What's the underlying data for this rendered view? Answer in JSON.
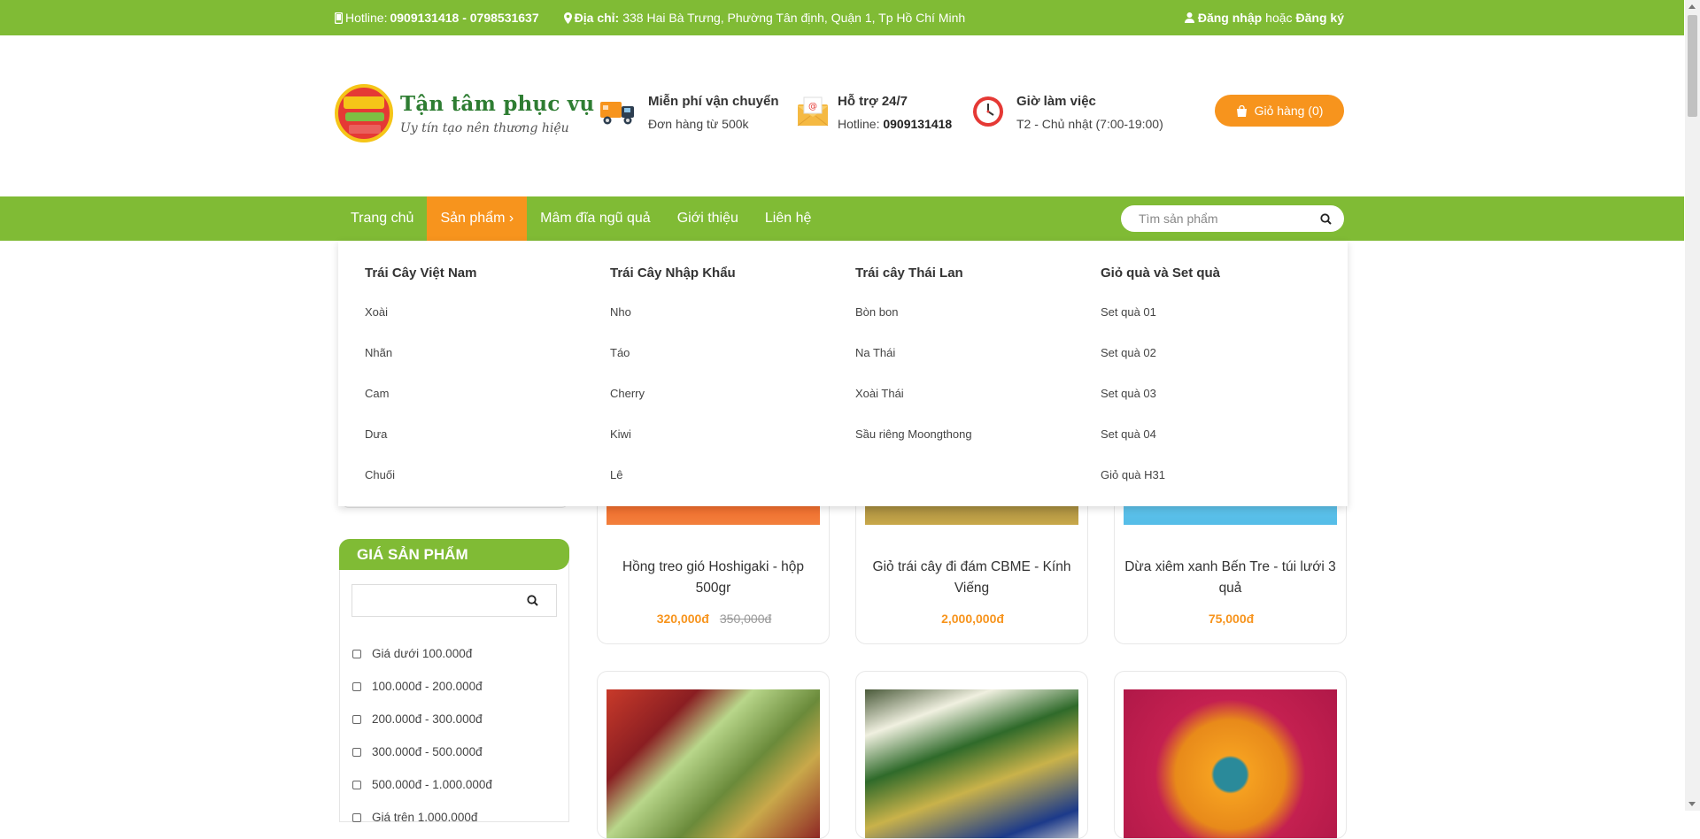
{
  "topbar": {
    "hotline_label": "Hotline:",
    "hotline_value": "0909131418 - 0798531637",
    "address_label": "Địa chỉ:",
    "address_value": "338 Hai Bà Trưng, Phường Tân định, Quận 1, Tp Hồ Chí Minh",
    "login": "Đăng nhập",
    "or": "hoặc",
    "register": "Đăng ký"
  },
  "header": {
    "logo_title": "Tận tâm phục vụ",
    "logo_slogan": "Uy tín tạo nên thương hiệu",
    "features": [
      {
        "icon": "delivery-truck-icon",
        "title": "Miễn phí vận chuyển",
        "sub": "Đơn hàng từ 500k"
      },
      {
        "icon": "email-support-icon",
        "title": "Hỗ trợ 24/7",
        "sub_label": "Hotline:",
        "sub_value": "0909131418"
      },
      {
        "icon": "clock-icon",
        "title": "Giờ làm việc",
        "sub": "T2 - Chủ nhật (7:00-19:00)"
      }
    ],
    "cart_label": "Giỏ hàng (0)"
  },
  "nav": {
    "items": [
      "Trang chủ",
      "Sản phẩm ›",
      "Mâm đĩa ngũ quả",
      "Giới thiệu",
      "Liên hệ"
    ],
    "active_index": 1,
    "search_placeholder": "Tìm sản phẩm"
  },
  "mega_menu": {
    "columns": [
      {
        "title": "Trái Cây Việt Nam",
        "items": [
          "Xoài",
          "Nhãn",
          "Cam",
          "Dưa",
          "Chuối"
        ]
      },
      {
        "title": "Trái Cây Nhập Khẩu",
        "items": [
          "Nho",
          "Táo",
          "Cherry",
          "Kiwi",
          "Lê"
        ]
      },
      {
        "title": "Trái cây Thái Lan",
        "items": [
          "Bòn bon",
          "Na Thái",
          "Xoài Thái",
          "Sầu riêng Moongthong"
        ]
      },
      {
        "title": "Giỏ quà và Set quà",
        "items": [
          "Set quà 01",
          "Set quà 02",
          "Set quà 03",
          "Set quà 04",
          "Giỏ quà H31"
        ]
      }
    ]
  },
  "sidebar": {
    "price_title": "GIÁ SẢN PHẨM",
    "price_options": [
      "Giá dưới 100.000đ",
      "100.000đ - 200.000đ",
      "200.000đ - 300.000đ",
      "300.000đ - 500.000đ",
      "500.000đ - 1.000.000đ",
      "Giá trên 1.000.000đ"
    ]
  },
  "products": [
    {
      "name": "Hồng treo gió Hoshigaki - hộp 500gr",
      "price": "320,000đ",
      "old_price": "350,000đ"
    },
    {
      "name": "Giỏ trái cây đi đám CBME - Kính Viếng",
      "price": "2,000,000đ",
      "old_price": ""
    },
    {
      "name": "Dừa xiêm xanh Bến Tre - túi lưới 3 quả",
      "price": "75,000đ",
      "old_price": ""
    },
    {
      "name": "",
      "price": "",
      "old_price": ""
    },
    {
      "name": "",
      "price": "",
      "old_price": ""
    },
    {
      "name": "",
      "price": "",
      "old_price": ""
    }
  ],
  "colors": {
    "green": "#80bb35",
    "orange": "#f7941d"
  }
}
